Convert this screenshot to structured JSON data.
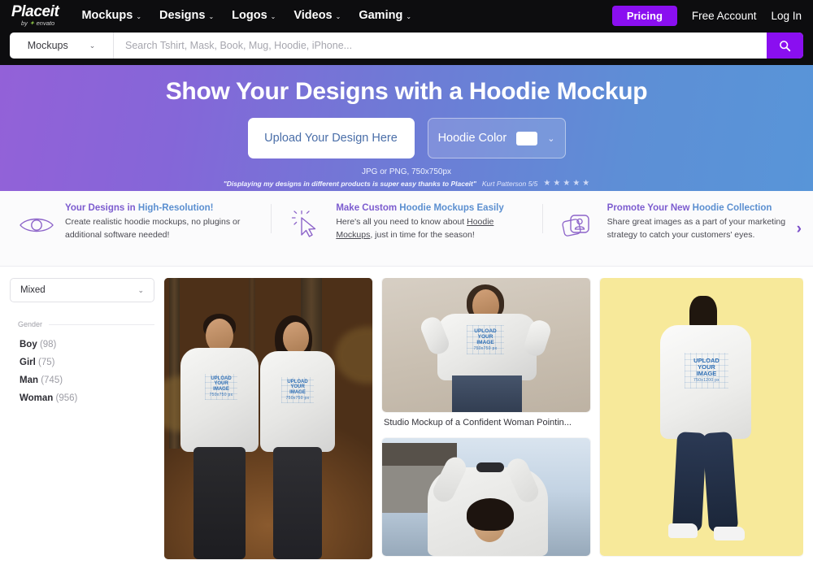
{
  "nav": {
    "logo_main": "Placeit",
    "logo_sub": "by envato",
    "items": [
      {
        "label": "Mockups"
      },
      {
        "label": "Designs"
      },
      {
        "label": "Logos"
      },
      {
        "label": "Videos"
      },
      {
        "label": "Gaming"
      }
    ],
    "caret": "⌄",
    "pricing": "Pricing",
    "free_account": "Free Account",
    "login": "Log In"
  },
  "search": {
    "category": "Mockups",
    "category_caret": "⌄",
    "placeholder": "Search Tshirt, Mask, Book, Mug, Hoodie, iPhone...",
    "value": "",
    "button_icon": "search-icon",
    "accent_color": "#8a0ff0"
  },
  "hero": {
    "title": "Show Your Designs with a Hoodie Mockup",
    "upload_label": "Upload Your Design Here",
    "color_label": "Hoodie Color",
    "color_value": "#ffffff",
    "color_caret": "⌄",
    "format_note": "JPG or PNG, 750x750px",
    "quote": "\"Displaying my designs in different products is super easy thanks to Placeit\"",
    "quote_author": "Kurt Patterson 5/5",
    "stars": [
      "★",
      "★",
      "★",
      "★",
      "★"
    ],
    "gradient_from": "#9361d8",
    "gradient_to": "#5895d8"
  },
  "features": {
    "next_icon": "›",
    "items": [
      {
        "icon": "eye-icon",
        "title_plain": "Your Designs in ",
        "title_accent": "High-Resolution!",
        "desc": "Create realistic hoodie mockups, no plugins or additional software needed!"
      },
      {
        "icon": "cursor-click-icon",
        "title_plain": "Make Custom ",
        "title_accent": "Hoodie Mockups Easily",
        "desc_before": "Here's all you need to know about ",
        "desc_link": "Hoodie Mockups",
        "desc_after": ", just in time for the season!"
      },
      {
        "icon": "photo-stack-person-icon",
        "title_plain": "Promote Your New ",
        "title_accent": "Hoodie Collection",
        "desc": "Share great images as a part of your marketing strategy to catch your customers' eyes."
      }
    ]
  },
  "sidebar": {
    "select_value": "Mixed",
    "select_caret": "⌄",
    "group_title": "Gender",
    "options": [
      {
        "label": "Boy",
        "count": "(98)"
      },
      {
        "label": "Girl",
        "count": "(75)"
      },
      {
        "label": "Man",
        "count": "(745)"
      },
      {
        "label": "Woman",
        "count": "(956)"
      }
    ]
  },
  "gallery": {
    "design_placeholder": {
      "line1": "UPLOAD",
      "line2": "YOUR",
      "line3": "IMAGE",
      "dims_square": "750x750 px",
      "dims_tall": "750x1200 px"
    },
    "cards": [
      {
        "name": "couple-park-hoodie-mockup",
        "caption": ""
      },
      {
        "name": "studio-woman-hoodie-mockup",
        "caption": "Studio Mockup of a Confident Woman Pointin..."
      },
      {
        "name": "outdoor-woman-hoodie-mockup",
        "caption": ""
      },
      {
        "name": "back-view-yellow-hoodie-mockup",
        "caption": ""
      }
    ]
  }
}
